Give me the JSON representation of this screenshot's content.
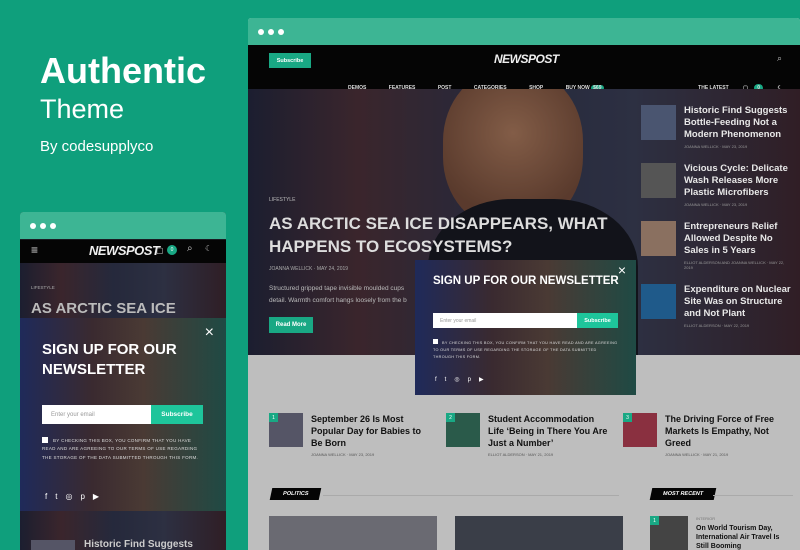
{
  "promo": {
    "title": "Authentic",
    "subtitle": "Theme",
    "by": "By codesupplyco"
  },
  "brand": {
    "accent": "#1ec59b",
    "background": "#0f9f7c"
  },
  "desktop": {
    "subscribe": "Subscribe",
    "logo": "NEWSPOST",
    "nav": [
      "DEMOS",
      "FEATURES",
      "POST",
      "CATEGORIES",
      "SHOP",
      "BUY NOW"
    ],
    "buy_badge": "$69",
    "latest": "THE LATEST",
    "cart_count": "0",
    "hero": {
      "category": "LIFESTYLE",
      "title": "AS ARCTIC SEA ICE DISAPPEARS, WHAT HAPPENS TO ECOSYSTEMS?",
      "author": "JOANNA WELLICK",
      "date": "MAY 24, 2019",
      "excerpt1": "Structured gripped tape invisible moulded cups",
      "excerpt2": "detail. Warmth comfort hangs loosely from the b",
      "read_more": "Read More"
    },
    "side": [
      {
        "title": "Historic Find Suggests Bottle-Feeding Not a Modern Phenomenon",
        "meta": "JOANNA WELLICK · MAY 23, 2019"
      },
      {
        "title": "Vicious Cycle: Delicate Wash Releases More Plastic Microfibers",
        "meta": "JOANNA WELLICK · MAY 23, 2019"
      },
      {
        "title": "Entrepreneurs Relief Allowed Despite No Sales in 5 Years",
        "meta": "ELLIOT ALDERSON AND JOANNA WELLICK · MAY 22, 2019"
      },
      {
        "title": "Expenditure on Nuclear Site Was on Structure and Not Plant",
        "meta": "ELLIOT ALDERSON · MAY 22, 2019"
      }
    ],
    "popup": {
      "title": "SIGN UP FOR OUR NEWSLETTER",
      "placeholder": "Enter your email",
      "button": "Subscribe",
      "consent": "BY CHECKING THIS BOX, YOU CONFIRM THAT YOU HAVE READ AND ARE AGREEING TO OUR TERMS OF USE REGARDING THE STORAGE OF THE DATA SUBMITTED THROUGH THIS FORM.",
      "close": "×"
    },
    "cards": [
      {
        "num": "1",
        "title": "September 26 Is Most Popular Day for Babies to Be Born",
        "meta": "JOANNA WELLICK · MAY 23, 2019"
      },
      {
        "num": "2",
        "title": "Student Accommodation Life ‘Being in There You Are Just a Number’",
        "meta": "ELLIOT ALDERSON · MAY 21, 2019"
      },
      {
        "num": "3",
        "title": "The Driving Force of Free Markets Is Empathy, Not Greed",
        "meta": "JOANNA WELLICK · MAY 21, 2019"
      }
    ],
    "politics": "POLITICS",
    "most_recent": "MOST RECENT",
    "recent": {
      "num": "1",
      "category": "INTERIOR",
      "title": "On World Tourism Day, International Air Travel Is Still Booming"
    }
  },
  "mobile": {
    "logo": "NEWSPOST",
    "cart_count": "0",
    "category": "LIFESTYLE",
    "title": "AS ARCTIC SEA ICE",
    "popup_title": "SIGN UP FOR OUR NEWSLETTER",
    "placeholder": "Enter your email",
    "button": "Subscribe",
    "consent": "BY CHECKING THIS BOX, YOU CONFIRM THAT YOU HAVE READ AND ARE AGREEING TO OUR TERMS OF USE REGARDING THE STORAGE OF THE DATA SUBMITTED THROUGH THIS FORM.",
    "next": "Historic Find Suggests",
    "close": "×"
  },
  "social_icons": [
    "facebook-icon",
    "twitter-icon",
    "instagram-icon",
    "pinterest-icon",
    "youtube-icon"
  ]
}
